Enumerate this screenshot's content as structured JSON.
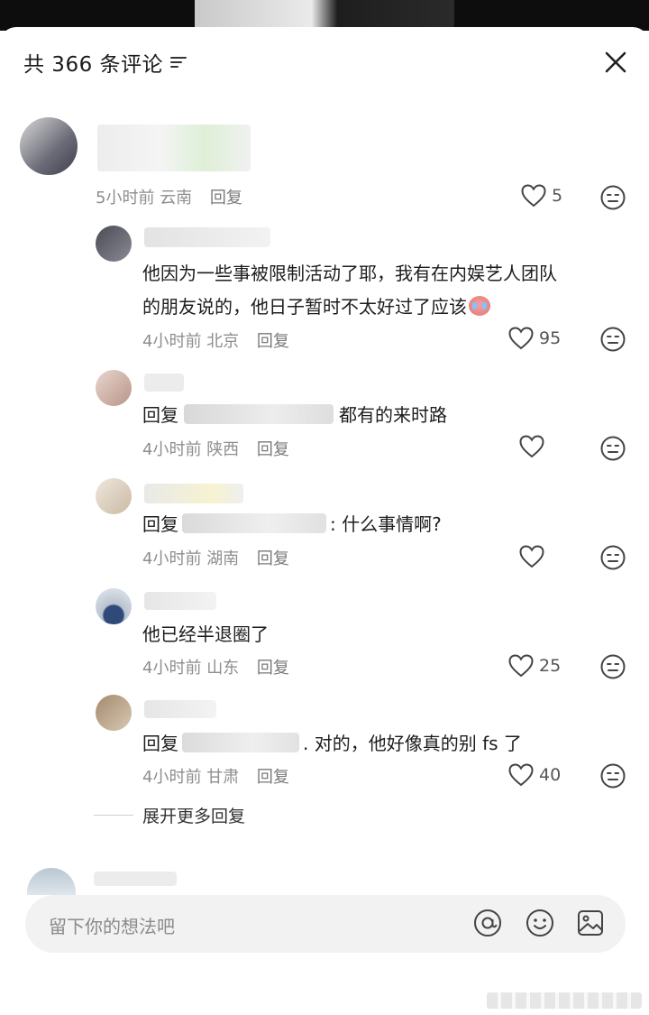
{
  "header": {
    "title": "共 366 条评论",
    "sort_icon": "sort-icon",
    "close_icon": "close-icon"
  },
  "comments": [
    {
      "name": "",
      "text": "",
      "time": "5小时前",
      "location": "云南",
      "reply": "回复",
      "likes": "5"
    },
    {
      "name": "",
      "text_line1": "他因为一些事被限制活动了耶，我有在内娱艺人团队",
      "text_line2": "的朋友说的，他日子暂时不太好过了应该",
      "emoji": "crying-emoji",
      "time": "4小时前",
      "location": "北京",
      "reply": "回复",
      "likes": "95"
    },
    {
      "reply_prefix": "回复",
      "text": "都有的来时路",
      "time": "4小时前",
      "location": "陕西",
      "reply": "回复",
      "likes": ""
    },
    {
      "reply_prefix": "回复",
      "text": ": 什么事情啊?",
      "time": "4小时前",
      "location": "湖南",
      "reply": "回复",
      "likes": ""
    },
    {
      "name": "",
      "text": "他已经半退圈了",
      "time": "4小时前",
      "location": "山东",
      "reply": "回复",
      "likes": "25"
    },
    {
      "reply_prefix": "回复",
      "text": ". 对的，他好像真的别 fs 了",
      "time": "4小时前",
      "location": "甘肃",
      "reply": "回复",
      "likes": "40"
    }
  ],
  "expand_more": "展开更多回复",
  "input": {
    "placeholder": "留下你的想法吧",
    "icons": [
      "at-icon",
      "emoji-icon",
      "image-icon"
    ]
  },
  "colors": {
    "text": "#1d1d1d",
    "meta": "#8e8e8e",
    "input_bg": "#f2f2f2"
  }
}
